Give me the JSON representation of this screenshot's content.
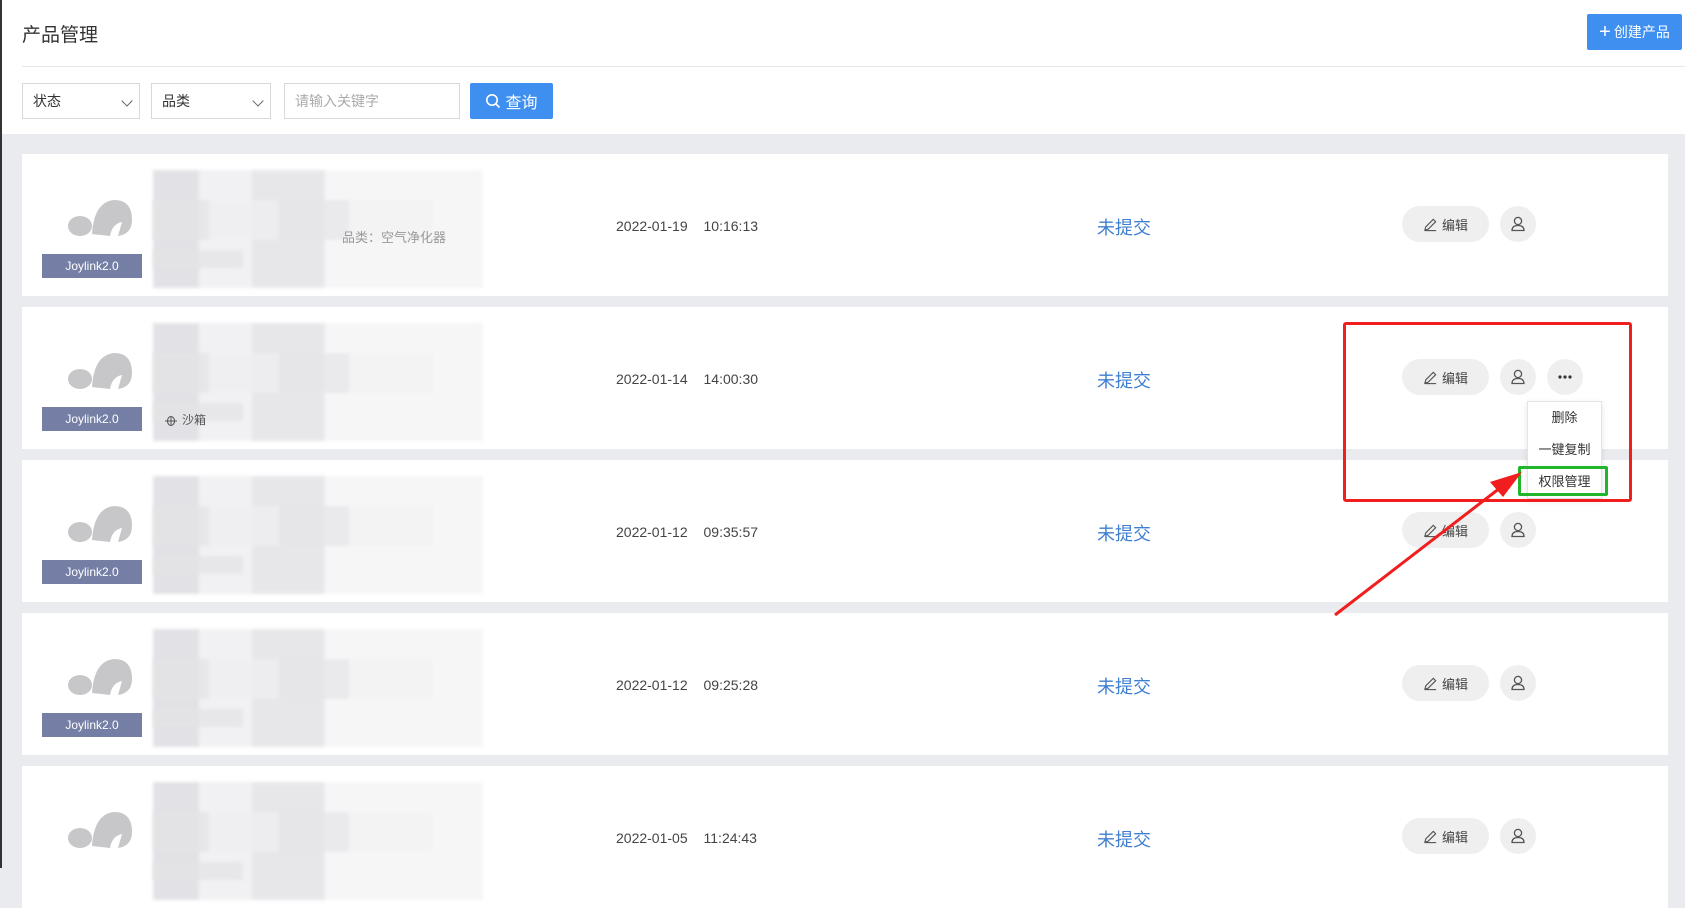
{
  "header": {
    "title": "产品管理",
    "create_label": "创建产品"
  },
  "filters": {
    "status_label": "状态",
    "category_label": "品类",
    "keyword_placeholder": "请输入关键字",
    "query_label": "查询"
  },
  "products": [
    {
      "badge": "Joylink2.0",
      "category_text": "品类：空气净化器",
      "meta_text": "",
      "date": "2022-01-19",
      "time": "10:16:13",
      "status": "未提交",
      "edit_label": "编辑"
    },
    {
      "badge": "Joylink2.0",
      "category_text": "",
      "meta_text": "沙箱",
      "date": "2022-01-14",
      "time": "14:00:30",
      "status": "未提交",
      "edit_label": "编辑"
    },
    {
      "badge": "Joylink2.0",
      "category_text": "",
      "meta_text": "",
      "date": "2022-01-12",
      "time": "09:35:57",
      "status": "未提交",
      "edit_label": "编辑"
    },
    {
      "badge": "Joylink2.0",
      "category_text": "",
      "meta_text": "",
      "date": "2022-01-12",
      "time": "09:25:28",
      "status": "未提交",
      "edit_label": "编辑"
    },
    {
      "badge": "",
      "category_text": "",
      "meta_text": "",
      "date": "2022-01-05",
      "time": "11:24:43",
      "status": "未提交",
      "edit_label": "编辑"
    }
  ],
  "more_menu": {
    "items": [
      "删除",
      "一键复制",
      "权限管理"
    ]
  },
  "annotation_colors": {
    "highlight": "#f01e1e",
    "target": "#21b52c"
  },
  "icons": {
    "create": "plus-icon",
    "query": "search-icon",
    "edit": "pencil-icon",
    "permission": "user-icon",
    "more": "ellipsis-icon",
    "sandbox": "bug-icon"
  }
}
